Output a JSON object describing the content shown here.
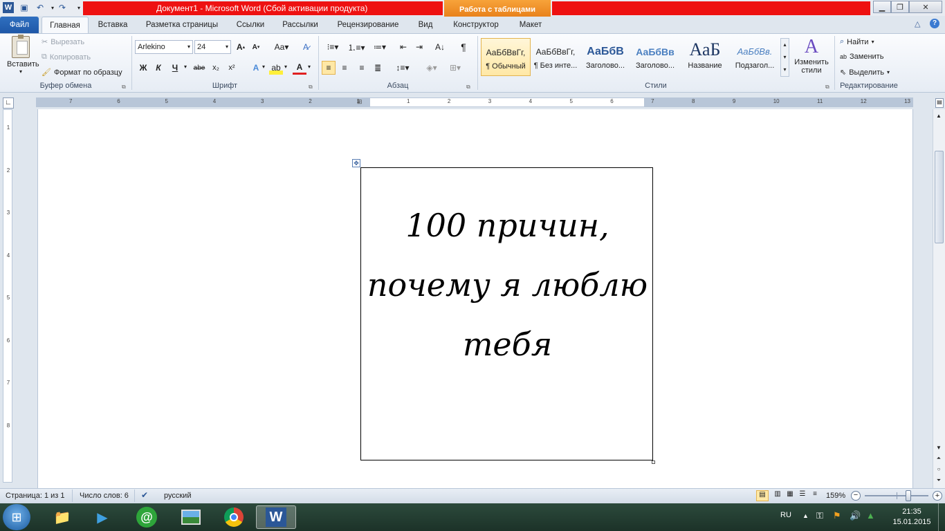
{
  "window": {
    "title": "Документ1  -  Microsoft Word (Сбой активации продукта)",
    "context_tab_group": "Работа с таблицами"
  },
  "tabs": [
    "Файл",
    "Главная",
    "Вставка",
    "Разметка страницы",
    "Ссылки",
    "Рассылки",
    "Рецензирование",
    "Вид",
    "Конструктор",
    "Макет"
  ],
  "clipboard": {
    "paste": "Вставить",
    "cut": "Вырезать",
    "copy": "Копировать",
    "format_painter": "Формат по образцу",
    "label": "Буфер обмена"
  },
  "font": {
    "name": "Arlekino",
    "size": "24",
    "label": "Шрифт",
    "bold": "Ж",
    "italic": "К",
    "underline": "Ч",
    "strike": "abe",
    "sub": "x₂",
    "sup": "x²"
  },
  "paragraph": {
    "label": "Абзац"
  },
  "styles": {
    "label": "Стили",
    "items": [
      {
        "sample": "АаБбВвГг,",
        "name": "¶ Обычный"
      },
      {
        "sample": "АаБбВвГг,",
        "name": "¶ Без инте..."
      },
      {
        "sample": "АаБбВ",
        "name": "Заголово..."
      },
      {
        "sample": "АаБбВв",
        "name": "Заголово..."
      },
      {
        "sample": "АаБ",
        "name": "Название"
      },
      {
        "sample": "АаБбВв.",
        "name": "Подзагол..."
      }
    ],
    "change": "Изменить стили"
  },
  "editing": {
    "label": "Редактирование",
    "find": "Найти",
    "replace": "Заменить",
    "select": "Выделить"
  },
  "ruler": {
    "h_left": [
      "7",
      "6",
      "5",
      "4",
      "3",
      "2",
      "1"
    ],
    "h_right": [
      "1",
      "2",
      "3",
      "4",
      "5",
      "6",
      "7",
      "8",
      "9",
      "10",
      "11",
      "12",
      "13"
    ],
    "v": [
      "1",
      "2",
      "3",
      "4",
      "5",
      "6",
      "7",
      "8"
    ]
  },
  "document": {
    "cell_text_lines": [
      "100 причин,",
      "почему я люблю",
      "тебя"
    ]
  },
  "status": {
    "page": "Страница: 1 из 1",
    "words": "Число слов: 6",
    "language": "русский",
    "zoom": "159%",
    "zoom_level": 0.68
  },
  "taskbar": {
    "lang": "RU",
    "time": "21:35",
    "date": "15.01.2015"
  }
}
